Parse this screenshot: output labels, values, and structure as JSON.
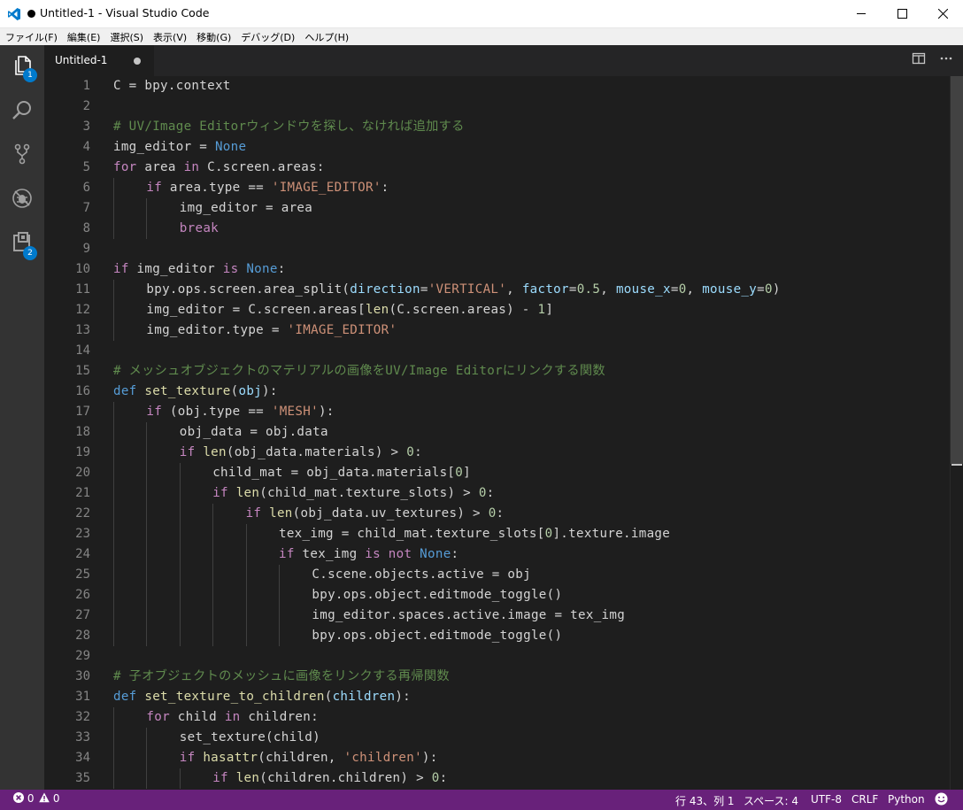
{
  "window": {
    "title": "Untitled-1 - Visual Studio Code"
  },
  "menu": [
    "ファイル(F)",
    "編集(E)",
    "選択(S)",
    "表示(V)",
    "移動(G)",
    "デバッグ(D)",
    "ヘルプ(H)"
  ],
  "activity": {
    "explorer_badge": "1",
    "extensions_badge": "2"
  },
  "tab": {
    "label": "Untitled-1"
  },
  "editor": {
    "language": "Python",
    "lines": [
      {
        "n": "1",
        "i": 0,
        "t": [
          [
            "C = bpy.context",
            ""
          ]
        ]
      },
      {
        "n": "2",
        "i": 0,
        "t": []
      },
      {
        "n": "3",
        "i": 0,
        "t": [
          [
            "# UV/Image Editorウィンドウを探し、なければ追加する",
            "com"
          ]
        ]
      },
      {
        "n": "4",
        "i": 0,
        "t": [
          [
            "img_editor = ",
            ""
          ],
          [
            "None",
            "kw"
          ]
        ]
      },
      {
        "n": "5",
        "i": 0,
        "t": [
          [
            "for",
            "kw2"
          ],
          [
            " area ",
            ""
          ],
          [
            "in",
            "kw2"
          ],
          [
            " C.screen.areas:",
            ""
          ]
        ]
      },
      {
        "n": "6",
        "i": 1,
        "t": [
          [
            "if",
            "kw2"
          ],
          [
            " area.type == ",
            ""
          ],
          [
            "'IMAGE_EDITOR'",
            "str"
          ],
          [
            ":",
            ""
          ]
        ]
      },
      {
        "n": "7",
        "i": 2,
        "t": [
          [
            "img_editor = area",
            ""
          ]
        ]
      },
      {
        "n": "8",
        "i": 2,
        "t": [
          [
            "break",
            "kw2"
          ]
        ]
      },
      {
        "n": "9",
        "i": 0,
        "t": []
      },
      {
        "n": "10",
        "i": 0,
        "t": [
          [
            "if",
            "kw2"
          ],
          [
            " img_editor ",
            ""
          ],
          [
            "is",
            "kw2"
          ],
          [
            " ",
            ""
          ],
          [
            "None",
            "kw"
          ],
          [
            ":",
            ""
          ]
        ]
      },
      {
        "n": "11",
        "i": 1,
        "t": [
          [
            "bpy.ops.screen.area_split(",
            ""
          ],
          [
            "direction",
            "param"
          ],
          [
            "=",
            ""
          ],
          [
            "'VERTICAL'",
            "str"
          ],
          [
            ", ",
            ""
          ],
          [
            "factor",
            "param"
          ],
          [
            "=",
            ""
          ],
          [
            "0.5",
            "num"
          ],
          [
            ", ",
            ""
          ],
          [
            "mouse_x",
            "param"
          ],
          [
            "=",
            ""
          ],
          [
            "0",
            "num"
          ],
          [
            ", ",
            ""
          ],
          [
            "mouse_y",
            "param"
          ],
          [
            "=",
            ""
          ],
          [
            "0",
            "num"
          ],
          [
            ")",
            ""
          ]
        ]
      },
      {
        "n": "12",
        "i": 1,
        "t": [
          [
            "img_editor = C.screen.areas[",
            ""
          ],
          [
            "len",
            "builtin"
          ],
          [
            "(C.screen.areas) - ",
            ""
          ],
          [
            "1",
            "num"
          ],
          [
            "]",
            ""
          ]
        ]
      },
      {
        "n": "13",
        "i": 1,
        "t": [
          [
            "img_editor.type = ",
            ""
          ],
          [
            "'IMAGE_EDITOR'",
            "str"
          ]
        ]
      },
      {
        "n": "14",
        "i": 0,
        "t": []
      },
      {
        "n": "15",
        "i": 0,
        "t": [
          [
            "# メッシュオブジェクトのマテリアルの画像をUV/Image Editorにリンクする関数",
            "com"
          ]
        ]
      },
      {
        "n": "16",
        "i": 0,
        "t": [
          [
            "def",
            "kw"
          ],
          [
            " ",
            ""
          ],
          [
            "set_texture",
            "fn"
          ],
          [
            "(",
            ""
          ],
          [
            "obj",
            "param"
          ],
          [
            "):",
            ""
          ]
        ]
      },
      {
        "n": "17",
        "i": 1,
        "t": [
          [
            "if",
            "kw2"
          ],
          [
            " (obj.type == ",
            ""
          ],
          [
            "'MESH'",
            "str"
          ],
          [
            "):",
            ""
          ]
        ]
      },
      {
        "n": "18",
        "i": 2,
        "t": [
          [
            "obj_data = obj.data",
            ""
          ]
        ]
      },
      {
        "n": "19",
        "i": 2,
        "t": [
          [
            "if",
            "kw2"
          ],
          [
            " ",
            ""
          ],
          [
            "len",
            "builtin"
          ],
          [
            "(obj_data.materials) > ",
            ""
          ],
          [
            "0",
            "num"
          ],
          [
            ":",
            ""
          ]
        ]
      },
      {
        "n": "20",
        "i": 3,
        "t": [
          [
            "child_mat = obj_data.materials[",
            ""
          ],
          [
            "0",
            "num"
          ],
          [
            "]",
            ""
          ]
        ]
      },
      {
        "n": "21",
        "i": 3,
        "t": [
          [
            "if",
            "kw2"
          ],
          [
            " ",
            ""
          ],
          [
            "len",
            "builtin"
          ],
          [
            "(child_mat.texture_slots) > ",
            ""
          ],
          [
            "0",
            "num"
          ],
          [
            ":",
            ""
          ]
        ]
      },
      {
        "n": "22",
        "i": 4,
        "t": [
          [
            "if",
            "kw2"
          ],
          [
            " ",
            ""
          ],
          [
            "len",
            "builtin"
          ],
          [
            "(obj_data.uv_textures) > ",
            ""
          ],
          [
            "0",
            "num"
          ],
          [
            ":",
            ""
          ]
        ]
      },
      {
        "n": "23",
        "i": 5,
        "t": [
          [
            "tex_img = child_mat.texture_slots[",
            ""
          ],
          [
            "0",
            "num"
          ],
          [
            "].texture.image",
            ""
          ]
        ]
      },
      {
        "n": "24",
        "i": 5,
        "t": [
          [
            "if",
            "kw2"
          ],
          [
            " tex_img ",
            ""
          ],
          [
            "is not",
            "kw2"
          ],
          [
            " ",
            ""
          ],
          [
            "None",
            "kw"
          ],
          [
            ":",
            ""
          ]
        ]
      },
      {
        "n": "25",
        "i": 6,
        "t": [
          [
            "C.scene.objects.active = obj",
            ""
          ]
        ]
      },
      {
        "n": "26",
        "i": 6,
        "t": [
          [
            "bpy.ops.object.editmode_toggle()",
            ""
          ]
        ]
      },
      {
        "n": "27",
        "i": 6,
        "t": [
          [
            "img_editor.spaces.active.image = tex_img",
            ""
          ]
        ]
      },
      {
        "n": "28",
        "i": 6,
        "t": [
          [
            "bpy.ops.object.editmode_toggle()",
            ""
          ]
        ]
      },
      {
        "n": "29",
        "i": 0,
        "t": []
      },
      {
        "n": "30",
        "i": 0,
        "t": [
          [
            "# 子オブジェクトのメッシュに画像をリンクする再帰関数",
            "com"
          ]
        ]
      },
      {
        "n": "31",
        "i": 0,
        "t": [
          [
            "def",
            "kw"
          ],
          [
            " ",
            ""
          ],
          [
            "set_texture_to_children",
            "fn"
          ],
          [
            "(",
            ""
          ],
          [
            "children",
            "param"
          ],
          [
            "):",
            ""
          ]
        ]
      },
      {
        "n": "32",
        "i": 1,
        "t": [
          [
            "for",
            "kw2"
          ],
          [
            " child ",
            ""
          ],
          [
            "in",
            "kw2"
          ],
          [
            " children:",
            ""
          ]
        ]
      },
      {
        "n": "33",
        "i": 2,
        "t": [
          [
            "set_texture(child)",
            ""
          ]
        ]
      },
      {
        "n": "34",
        "i": 2,
        "t": [
          [
            "if",
            "kw2"
          ],
          [
            " ",
            ""
          ],
          [
            "hasattr",
            "builtin"
          ],
          [
            "(children, ",
            ""
          ],
          [
            "'children'",
            "str"
          ],
          [
            "):",
            ""
          ]
        ]
      },
      {
        "n": "35",
        "i": 3,
        "t": [
          [
            "if",
            "kw2"
          ],
          [
            " ",
            ""
          ],
          [
            "len",
            "builtin"
          ],
          [
            "(children.children) > ",
            ""
          ],
          [
            "0",
            "num"
          ],
          [
            ":",
            ""
          ]
        ]
      }
    ]
  },
  "status": {
    "errors": "0",
    "warnings": "0",
    "position": "行 43、列 1",
    "indent": "スペース: 4",
    "encoding": "UTF-8",
    "eol": "CRLF",
    "language": "Python"
  },
  "colors": {
    "statusbar": "#68217a",
    "activitybar": "#333333",
    "editor_bg": "#1e1e1e",
    "badge": "#007acc"
  }
}
